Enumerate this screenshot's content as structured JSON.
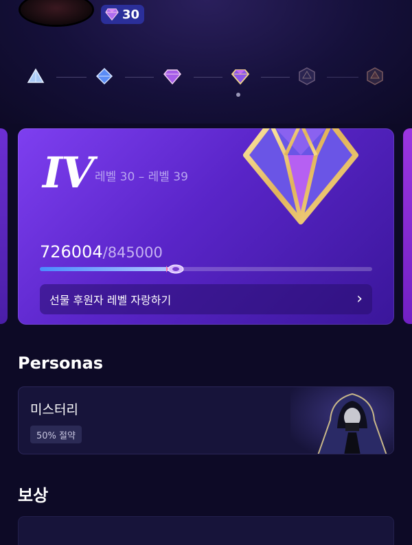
{
  "header": {
    "level_value": "30",
    "icons": {
      "level_gem": "diamond-icon",
      "avatar": "avatar"
    }
  },
  "tier_track": {
    "nodes": [
      {
        "icon": "tier1-icon",
        "state": "achieved"
      },
      {
        "icon": "tier2-icon",
        "state": "achieved"
      },
      {
        "icon": "tier3-icon",
        "state": "achieved"
      },
      {
        "icon": "tier4-icon",
        "state": "current"
      },
      {
        "icon": "tier5-icon",
        "state": "locked"
      },
      {
        "icon": "tier6-icon",
        "state": "locked"
      }
    ]
  },
  "tier_card": {
    "roman": "IV",
    "range": "레벨 30 – 레벨 39",
    "current_points": "726004",
    "max_points": "/845000",
    "progress_fraction": 0.41,
    "share_label": "선물 후원자 레벨 자랑하기",
    "share_chevron": "›"
  },
  "personas": {
    "title": "Personas",
    "item": {
      "name": "미스터리",
      "tag": "50% 절약"
    }
  },
  "rewards": {
    "title": "보상"
  },
  "colors": {
    "background": "#0d0a26",
    "card_start": "#7e3ff0",
    "card_end": "#3a169a",
    "badge": "#2b2f9a",
    "progress": "#4a8cff"
  }
}
